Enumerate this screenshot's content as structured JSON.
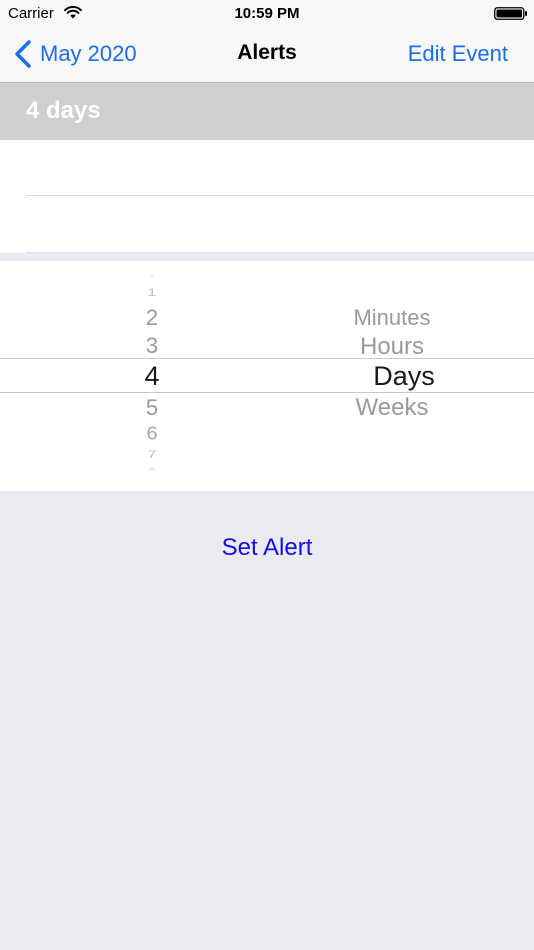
{
  "status_bar": {
    "carrier": "Carrier",
    "time": "10:59 PM"
  },
  "nav": {
    "back_label": "May 2020",
    "title": "Alerts",
    "right_label": "Edit Event"
  },
  "summary": {
    "text": "4 days"
  },
  "picker": {
    "numbers": [
      "0",
      "1",
      "2",
      "3",
      "4",
      "5",
      "6",
      "7",
      "8"
    ],
    "selected_number": "4",
    "units": [
      "Minutes",
      "Hours",
      "Days",
      "Weeks"
    ],
    "selected_unit": "Days"
  },
  "action": {
    "label": "Set Alert"
  },
  "colors": {
    "accent_blue": "#1b6ee8",
    "action_blue": "#1010e0",
    "header_gray": "#cfcfcf",
    "background": "#ebeaf0"
  }
}
